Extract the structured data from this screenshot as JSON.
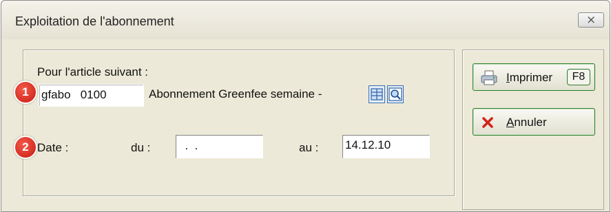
{
  "window": {
    "title": "Exploitation de l'abonnement",
    "close_glyph": "⨯"
  },
  "form": {
    "article_label": "Pour l'article suivant :",
    "article_code": "gfabo   0100",
    "article_description": "Abonnement Greenfee semaine -",
    "date_label": "Date :",
    "from_label": "du :",
    "from_value": "  .  .",
    "to_label": "au :",
    "to_value": "14.12.10"
  },
  "markers": {
    "one": "1",
    "two": "2"
  },
  "buttons": {
    "print_first_letter": "I",
    "print_rest": "mprimer",
    "print_shortcut": "F8",
    "cancel_first_letter": "A",
    "cancel_rest": "nnuler"
  },
  "icons": {
    "window_close": "close-icon",
    "article_list": "list-icon",
    "article_search": "magnifier-icon",
    "print": "printer-icon",
    "cancel": "red-x-icon"
  },
  "colors": {
    "window_bg": "#ece9d8",
    "marker_red": "#d42a1c",
    "button_border": "#2d7d2d",
    "field_border": "#7f9db9"
  }
}
